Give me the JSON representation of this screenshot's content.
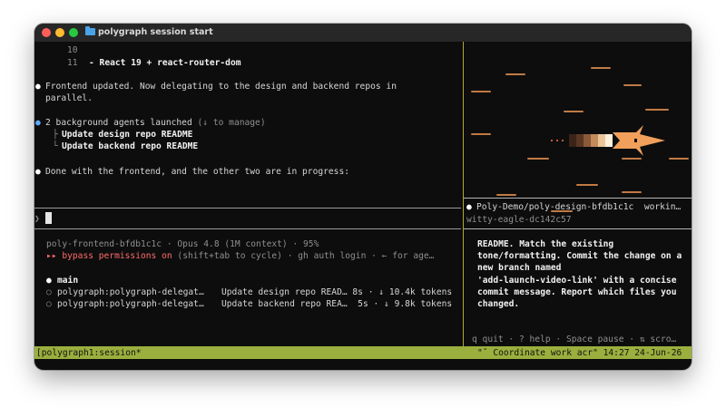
{
  "window": {
    "title": "polygraph session start"
  },
  "left": {
    "line10": "10",
    "line11_num": "11",
    "line11_text": "- React 19 + react-router-dom",
    "msg1_l1": "Frontend updated. Now delegating to the design and backend repos in",
    "msg1_l2": "parallel.",
    "agents_launched": "2 background agents launched ",
    "agents_hint": "(↓ to manage)",
    "agent1": "Update design repo README",
    "agent2": "Update backend repo README",
    "msg2": "Done with the frontend, and the other two are in progress:",
    "prompt_symbol": "❯",
    "model_line": "poly-frontend-bfdb1c1c · Opus 4.8 (1M context) · 95%",
    "bypass_arrows": "▸▸",
    "bypass_label": "bypass permissions on",
    "bypass_rest": " (shift+tab to cycle) · gh auth login · ← for age…",
    "main_label": "main",
    "task1_name": "polygraph:polygraph-delegat…",
    "task1_desc": "Update design repo READ… 8s · ↓ 10.4k tokens",
    "task2_name": "polygraph:polygraph-delegat…",
    "task2_desc": "Update backend repo REA…  5s · ↓ 9.8k tokens"
  },
  "right": {
    "header": "Poly-Demo/poly-design-bfdb1c1c  workin…",
    "sub": "witty-eagle-dc142c57",
    "body_l1": "README. Match the existing",
    "body_l2": "tone/formatting. Commit the change on a",
    "body_l3": "new branch named",
    "body_l4": "'add-launch-video-link' with a concise",
    "body_l5": "commit message. Report which files you",
    "body_l6": "changed.",
    "help": "q quit · ? help · Space pause · ⇅ scro…"
  },
  "status": {
    "left": "[polygraph1:session*",
    "right": "\"ˇ Coordinate work acr\" 14:27 24-Jun-26"
  },
  "colors": {
    "status_bar": "#9aaf3d",
    "accent_red": "#ff6b6b",
    "accent_blue": "#5aa9ff",
    "rocket": "#f0a05a"
  }
}
